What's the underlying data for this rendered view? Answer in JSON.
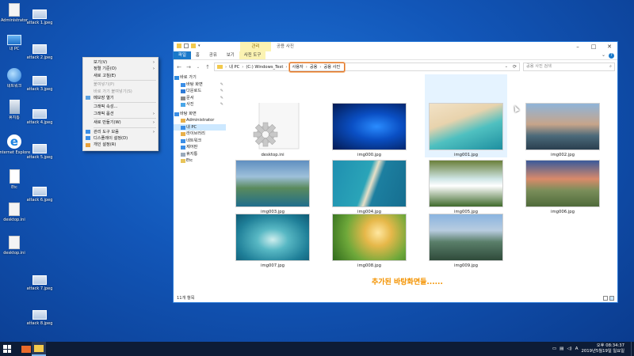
{
  "desktop": {
    "icons": [
      {
        "label": "Administrator",
        "type": "user-folder-icon"
      },
      {
        "label": "내 PC",
        "type": "pc-icon"
      },
      {
        "label": "네트워크",
        "type": "network-icon"
      },
      {
        "label": "휴지통",
        "type": "recycle-bin-icon"
      },
      {
        "label": "Internet Explorer",
        "type": "ie-icon"
      },
      {
        "label": "Etc",
        "type": "document-icon"
      },
      {
        "label": "desktop.ini",
        "type": "settings-file-icon"
      },
      {
        "label": "desktop.ini",
        "type": "settings-file-icon"
      },
      {
        "label": "attack 1.jpeg",
        "type": "image-file-icon"
      },
      {
        "label": "attack 2.jpeg",
        "type": "image-file-icon"
      },
      {
        "label": "attack 3.jpeg",
        "type": "image-file-icon"
      },
      {
        "label": "attack 4.jpeg",
        "type": "image-file-icon"
      },
      {
        "label": "attack 5.jpeg",
        "type": "image-file-icon"
      },
      {
        "label": "attack 6.jpeg",
        "type": "image-file-icon"
      },
      {
        "label": "attack 7.jpeg",
        "type": "image-file-icon"
      },
      {
        "label": "attack 8.jpeg",
        "type": "image-file-icon"
      }
    ]
  },
  "context_menu": {
    "items": [
      {
        "label": "보기(V)",
        "submenu": true,
        "disabled": false
      },
      {
        "label": "정렬 기준(O)",
        "submenu": true,
        "disabled": false
      },
      {
        "label": "새로 고침(E)",
        "submenu": false,
        "disabled": false
      },
      {
        "sep": true
      },
      {
        "label": "붙여넣기(P)",
        "submenu": false,
        "disabled": true
      },
      {
        "label": "바로 가기 붙여넣기(S)",
        "submenu": false,
        "disabled": true
      },
      {
        "label": "메모장 열기",
        "submenu": false,
        "disabled": false
      },
      {
        "sep": true
      },
      {
        "label": "그래픽 속성...",
        "submenu": false,
        "disabled": false
      },
      {
        "label": "그래픽 옵션",
        "submenu": true,
        "disabled": false
      },
      {
        "sep": true
      },
      {
        "label": "새로 만들기(W)",
        "submenu": true,
        "disabled": false
      },
      {
        "sep": true
      },
      {
        "label": "관리 도구 모음",
        "submenu": true,
        "disabled": false
      },
      {
        "label": "디스플레이 설정(D)",
        "submenu": false,
        "disabled": false
      },
      {
        "label": "개인 설정(R)",
        "submenu": false,
        "disabled": false
      }
    ]
  },
  "explorer": {
    "context_tab_header": "관리",
    "window_title": "공용 사진",
    "tabs": [
      {
        "label": "파일",
        "kind": "file"
      },
      {
        "label": "홈",
        "kind": "normal"
      },
      {
        "label": "공유",
        "kind": "normal"
      },
      {
        "label": "보기",
        "kind": "normal"
      },
      {
        "label": "사진 도구",
        "kind": "ctx"
      }
    ],
    "address": {
      "segments": [
        "내 PC",
        "(C:) Windows_Test"
      ],
      "highlighted": [
        "사용자",
        "공용",
        "공용 사진"
      ]
    },
    "search_placeholder": "공용 사진 검색",
    "nav": [
      {
        "label": "바로 가기",
        "level": 0,
        "pinned": false,
        "color": "#2f8be0"
      },
      {
        "label": "바탕 화면",
        "level": 1,
        "pinned": true,
        "color": "#3b8ee6"
      },
      {
        "label": "다운로드",
        "level": 1,
        "pinned": true,
        "color": "#2f7bd6"
      },
      {
        "label": "문서",
        "level": 1,
        "pinned": true,
        "color": "#8a8a8a"
      },
      {
        "label": "사진",
        "level": 1,
        "pinned": true,
        "color": "#4aa6e8"
      },
      {
        "gap": true
      },
      {
        "label": "바탕 화면",
        "level": 0,
        "pinned": false,
        "color": "#3b8ee6"
      },
      {
        "label": "Administrator",
        "level": 1,
        "pinned": false,
        "color": "#e8b04a"
      },
      {
        "label": "내 PC",
        "level": 1,
        "pinned": false,
        "color": "#3b8ee6",
        "selected": true
      },
      {
        "label": "라이브러리",
        "level": 1,
        "pinned": false,
        "color": "#e8b04a"
      },
      {
        "label": "네트워크",
        "level": 1,
        "pinned": false,
        "color": "#3b8ee6"
      },
      {
        "label": "제어판",
        "level": 1,
        "pinned": false,
        "color": "#3b8ee6"
      },
      {
        "label": "휴지통",
        "level": 1,
        "pinned": false,
        "color": "#9aaabb"
      },
      {
        "label": "Etc",
        "level": 1,
        "pinned": false,
        "color": "#e8c45a"
      }
    ],
    "files": [
      {
        "name": "desktop.ini",
        "kind": "gear"
      },
      {
        "name": "img000.jpg",
        "kind": "image",
        "bg": "radial-gradient(ellipse at 60% 50%, #2a8cff 0%, #0a4fc4 40%, #031a52 100%)"
      },
      {
        "name": "img001.jpg",
        "kind": "image",
        "bg": "linear-gradient(160deg, #f2e2c6 0%, #e8d3ad 35%, #4fc0c0 60%, #1e8fa0 100%)"
      },
      {
        "name": "img002.jpg",
        "kind": "image",
        "bg": "linear-gradient(180deg, #8fb4d8 0%, #c7a58a 45%, #4c6a7a 70%, #2a3f4f 100%)"
      },
      {
        "name": "img003.jpg",
        "kind": "image",
        "bg": "linear-gradient(180deg, #5f8fc0 0%, #9ec0da 35%, #5a8a5c 60%, #1f6e8c 100%)"
      },
      {
        "name": "img004.jpg",
        "kind": "image",
        "bg": "linear-gradient(110deg, #1f8fb0 0%, #2aa4b8 45%, #e8e0c8 52%, #1c7fa0 60%, #166e90 100%)"
      },
      {
        "name": "img005.jpg",
        "kind": "image",
        "bg": "linear-gradient(180deg, #6a7f3a 0%, #cfe6e6 40%, #ffffff 55%, #3f6a2c 100%)"
      },
      {
        "name": "img006.jpg",
        "kind": "image",
        "bg": "linear-gradient(180deg, #3a5a9a 0%, #d98a6a 40%, #7a8e5a 65%, #4f6a3a 100%)"
      },
      {
        "name": "img007.jpg",
        "kind": "image",
        "bg": "radial-gradient(ellipse at 50% 55%, #cfeeee 0%, #58b8c4 30%, #1f7f98 70%, #0f5a74 100%)"
      },
      {
        "name": "img008.jpg",
        "kind": "image",
        "bg": "radial-gradient(circle at 62% 40%, #ffe7a0 0%, #e6b84a 25%, #6ea83a 60%, #2f6a1c 100%)"
      },
      {
        "name": "img009.jpg",
        "kind": "image",
        "bg": "linear-gradient(180deg, #8ab4e0 0%, #b8cce0 35%, #5a7f6a 60%, #2f4a3a 100%)"
      }
    ],
    "status_count": "11개 항목",
    "caption": "추가된 바탕화면들......"
  },
  "taskbar": {
    "clock_time": "오후 08:34:37",
    "clock_date": "2019년5월19일 일요일"
  }
}
